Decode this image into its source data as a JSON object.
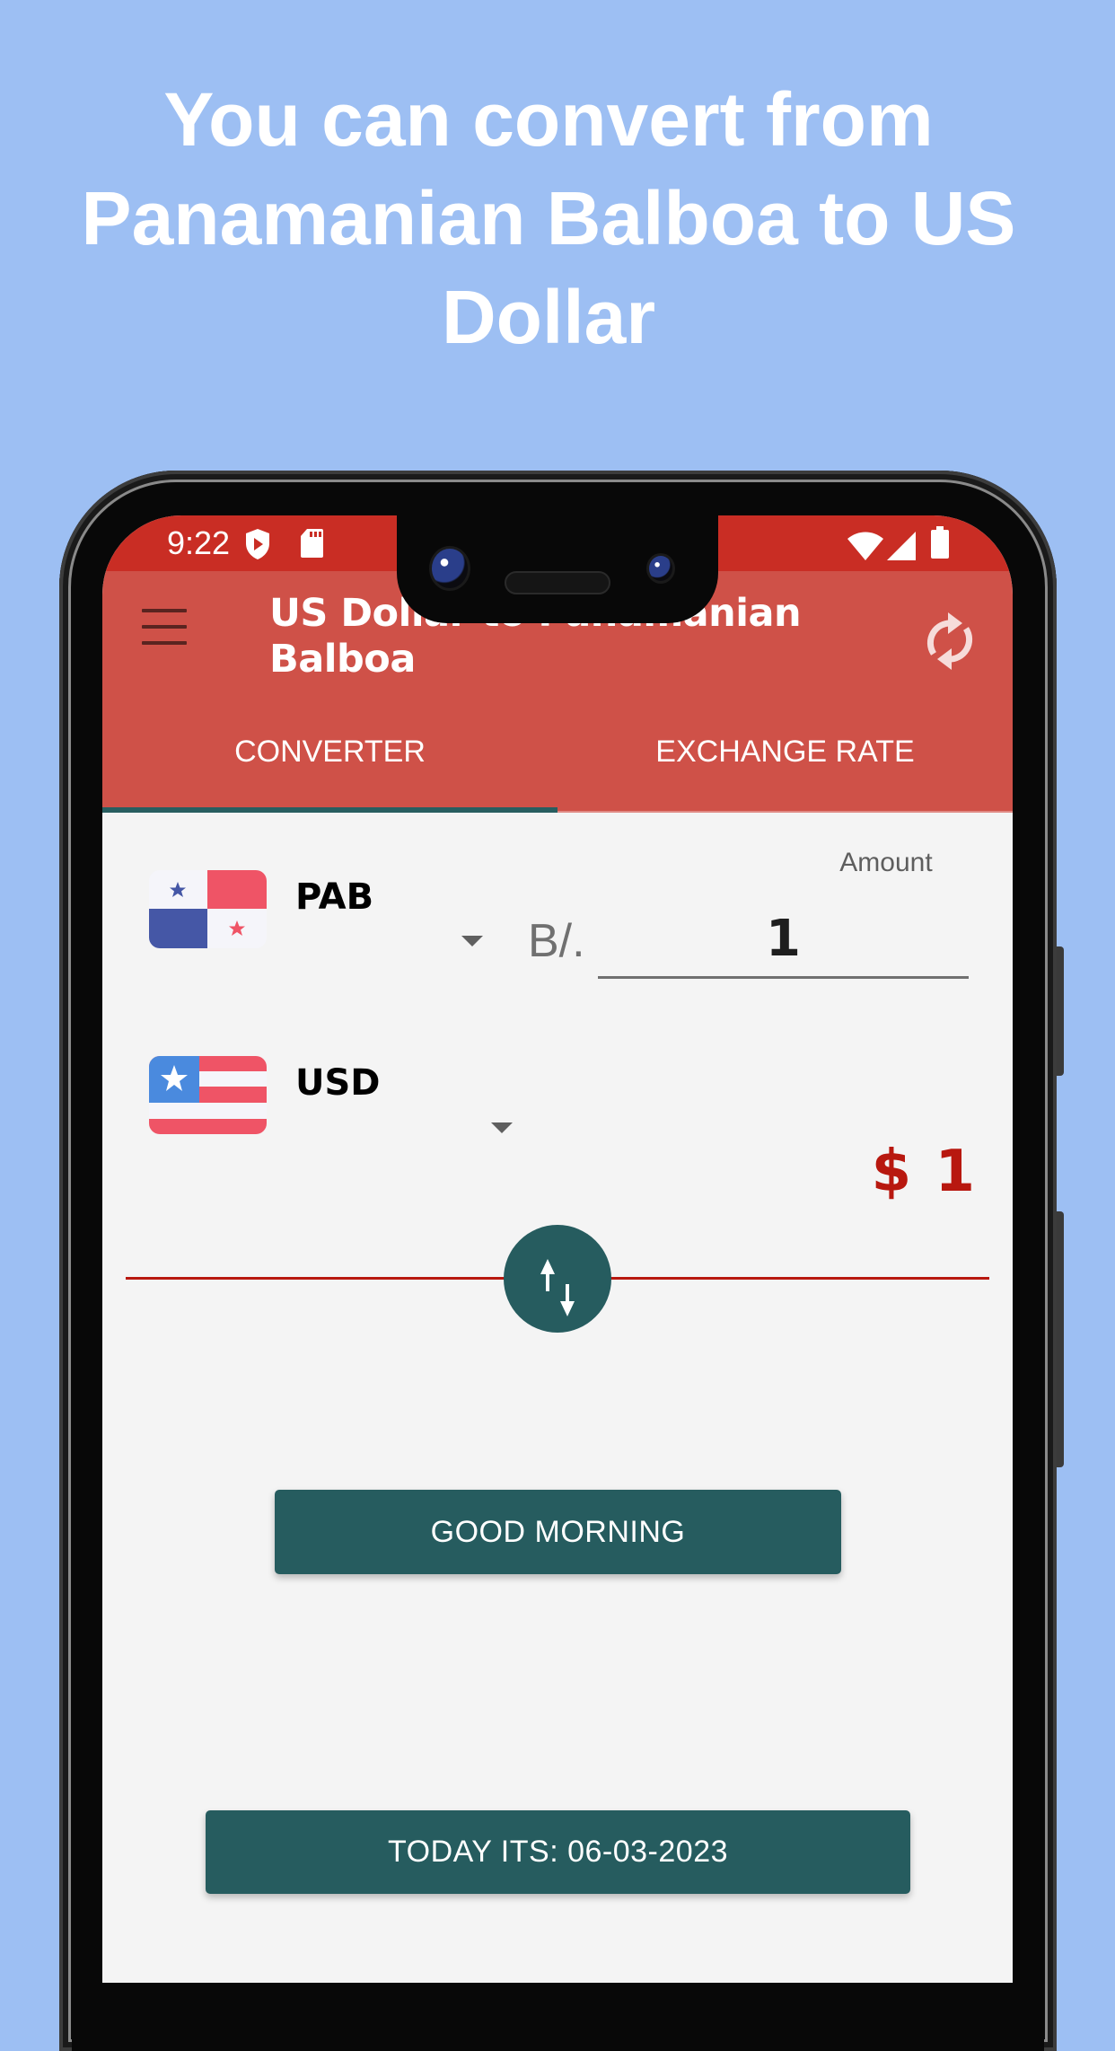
{
  "headline": "You can convert from Panamanian Balboa to US Dollar",
  "status_bar": {
    "time": "9:22",
    "left_icons": [
      "play-protect-shield-icon",
      "sd-card-icon"
    ],
    "right_icons": [
      "wifi-icon",
      "cell-signal-icon",
      "battery-icon"
    ]
  },
  "toolbar": {
    "menu_icon": "hamburger-menu-icon",
    "title": "US Dollar to Panamanian Balboa",
    "refresh_icon": "refresh-icon"
  },
  "tabs": [
    {
      "label": "CONVERTER",
      "active": true
    },
    {
      "label": "EXCHANGE RATE",
      "active": false
    }
  ],
  "converter": {
    "from": {
      "code": "PAB",
      "flag": "panama-flag",
      "symbol": "B/."
    },
    "amount": {
      "label": "Amount",
      "value": "1"
    },
    "to": {
      "code": "USD",
      "flag": "us-flag"
    },
    "result": "$ 1",
    "swap_icon": "swap-vertical-icon"
  },
  "buttons": {
    "greeting": "GOOD MORNING",
    "date": "TODAY ITS: 06-03-2023"
  },
  "colors": {
    "status_bar": "#C92D24",
    "toolbar": "#CF5148",
    "accent_teal": "#265C5F",
    "result_red": "#B8180F",
    "page_background": "#9DBFF3",
    "content_background": "#F4F4F4"
  }
}
